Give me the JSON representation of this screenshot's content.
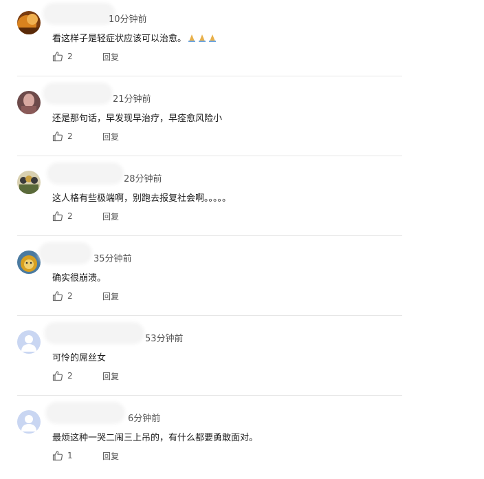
{
  "comments": [
    {
      "time": "10分钟前",
      "text": "看这样子是轻症状应该可以治愈。",
      "emoji": "folded-hands x3",
      "likes": "2",
      "reply_label": "回复",
      "avatar_icon": "avatar-photo-orange"
    },
    {
      "time": "21分钟前",
      "text": "还是那句话，早发现早治疗，早痊愈风险小",
      "likes": "2",
      "reply_label": "回复",
      "avatar_icon": "avatar-photo-portrait"
    },
    {
      "time": "28分钟前",
      "text": "这人格有些极端啊，别跑去报复社会啊。。。。。",
      "likes": "2",
      "reply_label": "回复",
      "avatar_icon": "avatar-photo-group"
    },
    {
      "time": "35分钟前",
      "text": "确实很崩溃。",
      "likes": "2",
      "reply_label": "回复",
      "avatar_icon": "avatar-photo-lion"
    },
    {
      "time": "53分钟前",
      "text": "可怜的屌丝女",
      "likes": "2",
      "reply_label": "回复",
      "avatar_icon": "default-user-icon"
    },
    {
      "time": "6分钟前",
      "text": "最烦这种一哭二闹三上吊的，有什么都要勇敢面对。",
      "likes": "1",
      "reply_label": "回复",
      "avatar_icon": "default-user-icon"
    }
  ],
  "colors": {
    "default_avatar_bg": "#c9d6f2",
    "default_avatar_fg": "#ffffff",
    "divider": "#e6e6e6",
    "muted_text": "#555555"
  }
}
